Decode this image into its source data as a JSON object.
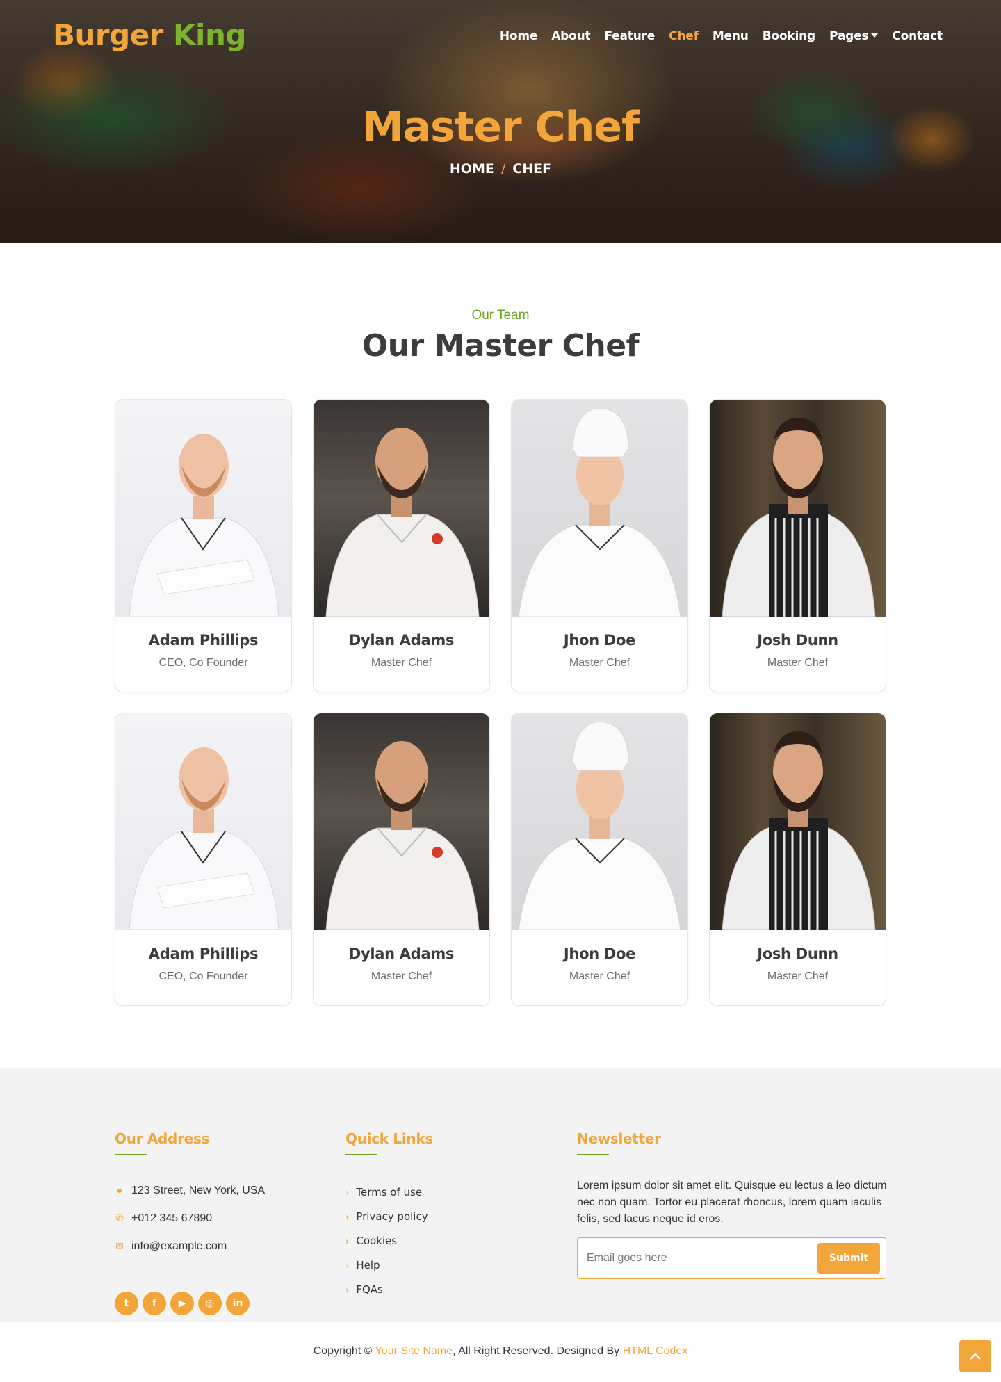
{
  "header": {
    "brand_part1": "Burger",
    "brand_part2": "King",
    "nav": [
      {
        "label": "Home"
      },
      {
        "label": "About"
      },
      {
        "label": "Feature"
      },
      {
        "label": "Chef",
        "active": true
      },
      {
        "label": "Menu"
      },
      {
        "label": "Booking"
      },
      {
        "label": "Pages",
        "dropdown": true
      },
      {
        "label": "Contact"
      }
    ]
  },
  "hero": {
    "title": "Master Chef",
    "breadcrumb": [
      "HOME",
      "/",
      "CHEF"
    ]
  },
  "team": {
    "subtitle": "Our Team",
    "title": "Our Master Chef",
    "members": [
      {
        "name": "Adam Phillips",
        "role": "CEO, Co Founder"
      },
      {
        "name": "Dylan Adams",
        "role": "Master Chef"
      },
      {
        "name": "Jhon Doe",
        "role": "Master Chef"
      },
      {
        "name": "Josh Dunn",
        "role": "Master Chef"
      },
      {
        "name": "Adam Phillips",
        "role": "CEO, Co Founder"
      },
      {
        "name": "Dylan Adams",
        "role": "Master Chef"
      },
      {
        "name": "Jhon Doe",
        "role": "Master Chef"
      },
      {
        "name": "Josh Dunn",
        "role": "Master Chef"
      }
    ]
  },
  "footer": {
    "address": {
      "title": "Our Address",
      "items": [
        {
          "icon": "map-marker-icon",
          "text": "123 Street, New York, USA"
        },
        {
          "icon": "phone-icon",
          "text": "+012 345 67890"
        },
        {
          "icon": "envelope-icon",
          "text": "info@example.com"
        }
      ],
      "socials": [
        "twitter-icon",
        "facebook-icon",
        "youtube-icon",
        "instagram-icon",
        "linkedin-icon"
      ]
    },
    "quick_links": {
      "title": "Quick Links",
      "links": [
        "Terms of use",
        "Privacy policy",
        "Cookies",
        "Help",
        "FQAs"
      ]
    },
    "newsletter": {
      "title": "Newsletter",
      "text": "Lorem ipsum dolor sit amet elit. Quisque eu lectus a leo dictum nec non quam. Tortor eu placerat rhoncus, lorem quam iaculis felis, sed lacus neque id eros.",
      "placeholder": "Email goes here",
      "button": "Submit"
    }
  },
  "copyright": {
    "prefix": "Copyright © ",
    "site": "Your Site Name",
    "middle": ", All Right Reserved. Designed By ",
    "designer": "HTML Codex"
  },
  "colors": {
    "accent": "#f2a63a",
    "green": "#6aa31e"
  }
}
